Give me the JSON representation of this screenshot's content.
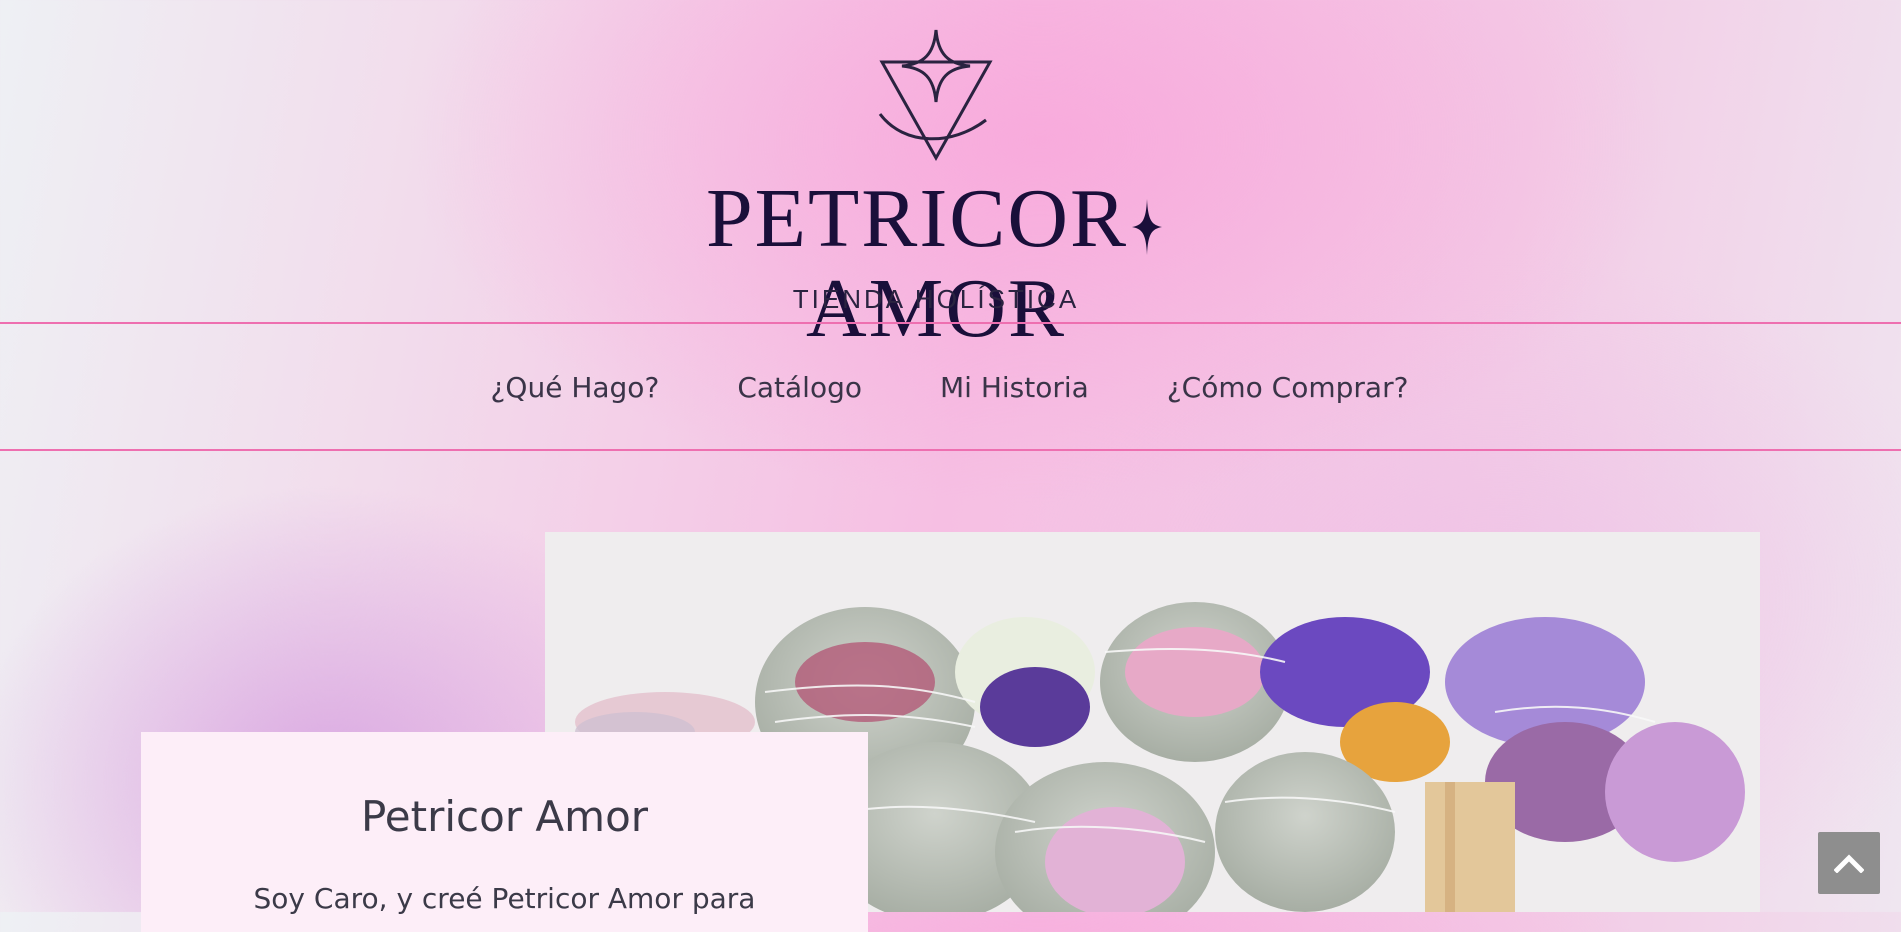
{
  "header": {
    "brand_name": "PETRICOR AMOR",
    "brand_left": "PETRICOR",
    "brand_right": "AMOR",
    "tagline": "TIENDA HOLÍSTICA",
    "logo_icon": "triangle-star-icon"
  },
  "nav": {
    "items": [
      {
        "label": "¿Qué Hago?"
      },
      {
        "label": "Catálogo"
      },
      {
        "label": "Mi Historia"
      },
      {
        "label": "¿Cómo Comprar?"
      }
    ]
  },
  "hero": {
    "image_subject": "bundles of dried sage and flowers",
    "card_title": "Petricor Amor",
    "card_text": "Soy Caro, y creé Petricor Amor para"
  },
  "scroll_top": {
    "icon": "chevron-up-icon"
  },
  "colors": {
    "accent_line": "#ee6fb0",
    "brand_text": "#1a0f3a",
    "card_bg": "#fdeef8",
    "scroll_button": "#8e8e8e"
  }
}
